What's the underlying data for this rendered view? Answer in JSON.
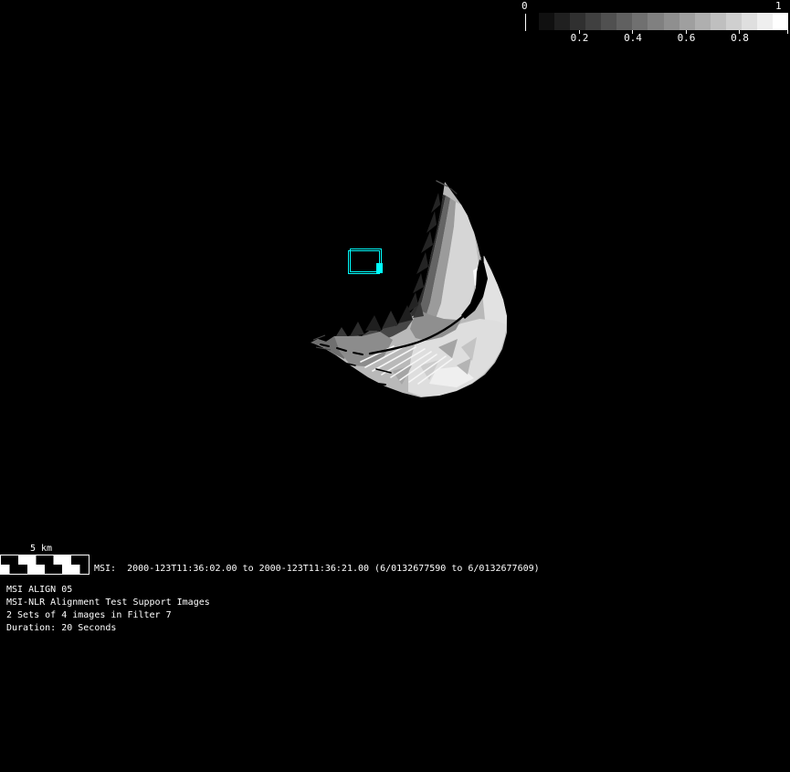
{
  "colors": {
    "background": "#000000",
    "foreground": "#ffffff",
    "accent_footprint": "#00ffff"
  },
  "colorbar": {
    "min_label": "0",
    "max_label": "1",
    "steps": 16,
    "ticks": [
      0.2,
      0.4,
      0.6,
      0.8
    ],
    "tick_labels": [
      "0.2",
      "0.4",
      "0.6",
      "0.8"
    ]
  },
  "footprint": {
    "color": "#00ffff"
  },
  "scalebar": {
    "label": "5 km"
  },
  "status_line": "MSI:  2000-123T11:36:02.00 to 2000-123T11:36:21.00 (6/0132677590 to 6/0132677609)",
  "info_lines": {
    "0": "MSI ALIGN 05",
    "1": "MSI-NLR Alignment Test Support Images",
    "2": "2 Sets of 4 images in Filter 7",
    "3": "Duration: 20 Seconds"
  }
}
